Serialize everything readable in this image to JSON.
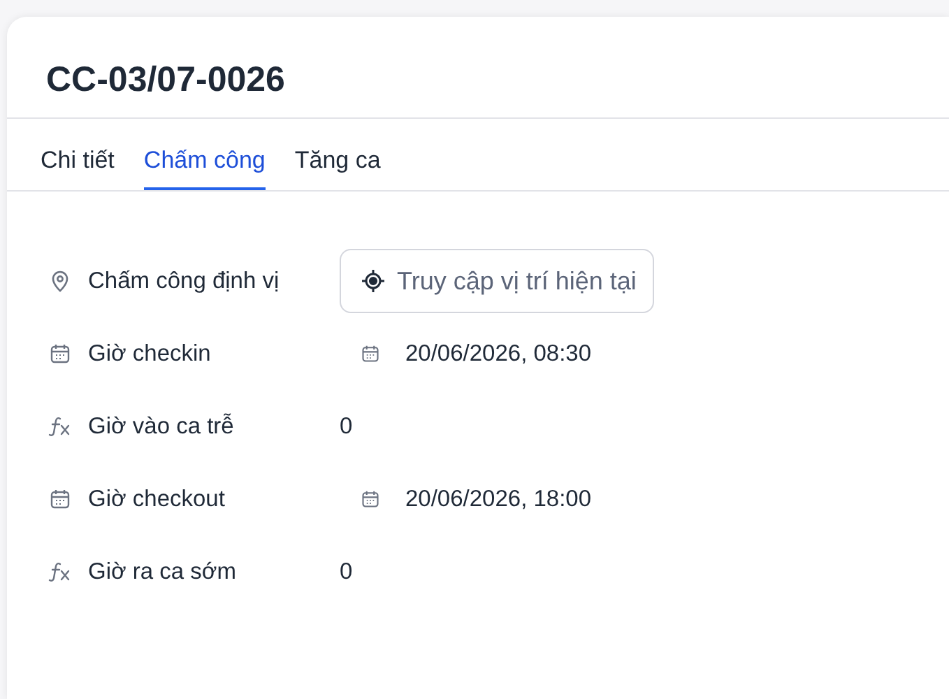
{
  "title": "CC-03/07-0026",
  "tabs": [
    {
      "label": "Chi tiết",
      "selected": false
    },
    {
      "label": "Chấm công",
      "selected": true
    },
    {
      "label": "Tăng ca",
      "selected": false
    }
  ],
  "fields": [
    {
      "kind": "location",
      "label": "Chấm công định vị",
      "button": "Truy cập vị trí hiện tại"
    },
    {
      "kind": "datetime",
      "label": "Giờ checkin",
      "value": "20/06/2026, 08:30"
    },
    {
      "kind": "formula",
      "label": "Giờ vào ca trễ",
      "value": "0"
    },
    {
      "kind": "datetime",
      "label": "Giờ checkout",
      "value": "20/06/2026, 18:00"
    },
    {
      "kind": "formula",
      "label": "Giờ ra ca sớm",
      "value": "0"
    }
  ]
}
